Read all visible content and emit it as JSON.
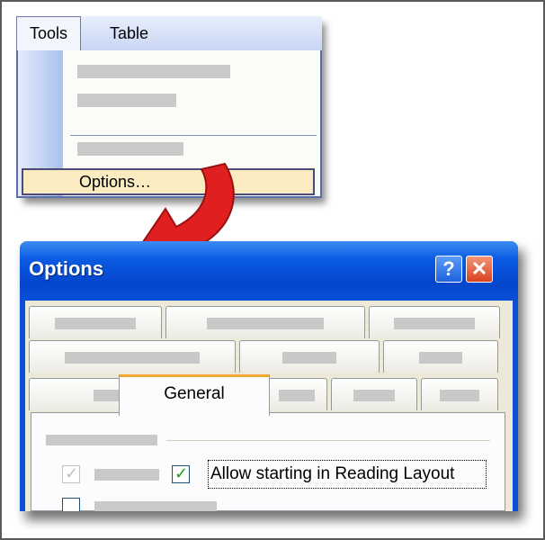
{
  "menubar": {
    "tools_label": "Tools",
    "table_label": "Table"
  },
  "menu": {
    "highlighted_item": "Options…",
    "highlight_color": "#fbebc0"
  },
  "dialog": {
    "title": "Options",
    "help_label": "?",
    "close_label": "✕",
    "active_tab": "General",
    "checkbox_label": "Allow starting in Reading Layout",
    "checkbox_checked": true,
    "titlebar_color": "#0a5be3"
  },
  "arrow": {
    "color": "#e02020"
  }
}
